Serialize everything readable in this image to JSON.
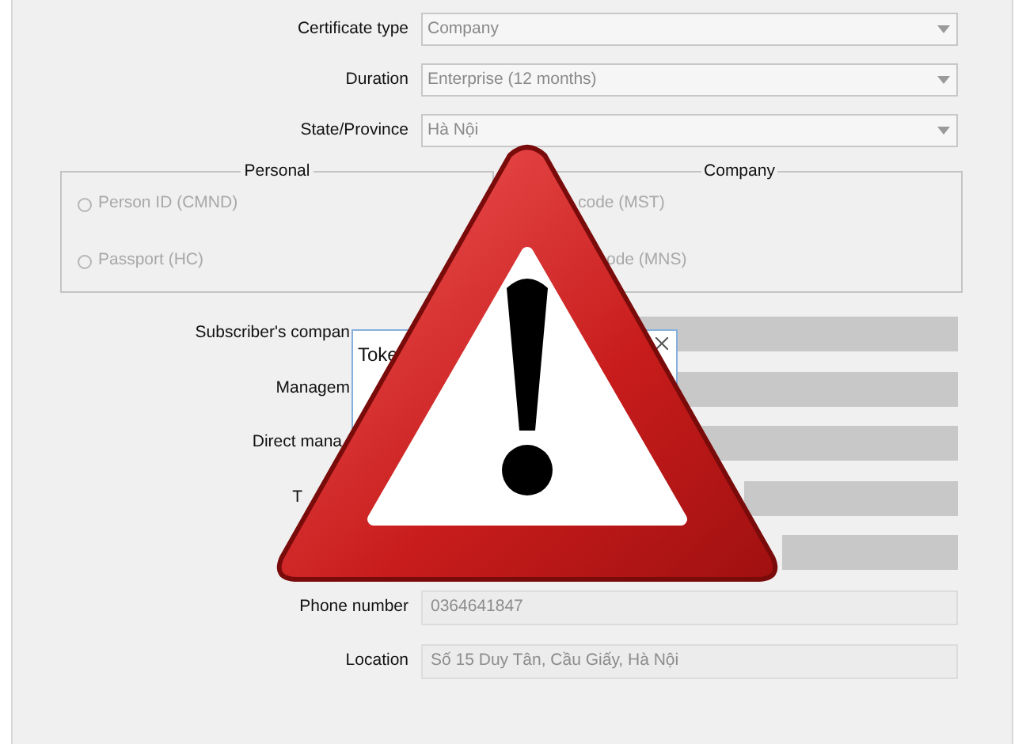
{
  "top_fields": [
    {
      "label": "Certificate type",
      "value": "Company"
    },
    {
      "label": "Duration",
      "value": "Enterprise (12 months)"
    },
    {
      "label": "State/Province",
      "value": "Hà Nội"
    }
  ],
  "groups": [
    {
      "title": "Personal",
      "options": [
        {
          "label": "Person ID (CMND)",
          "selected": false,
          "disabled": true
        },
        {
          "label": "Passport (HC)",
          "selected": false,
          "disabled": true
        }
      ]
    },
    {
      "title": "Company",
      "options": [
        {
          "label": "code (MST)",
          "disabled": true
        },
        {
          "label": "ode (MNS)",
          "disabled": true
        }
      ]
    }
  ],
  "token_dialog": {
    "title": "Toke"
  },
  "fields": [
    {
      "label": "Subscriber's compan",
      "disabled": true
    },
    {
      "label": "Managem",
      "disabled": true
    },
    {
      "label": "Direct mana",
      "disabled": true
    },
    {
      "label": "T",
      "disabled": true
    },
    {
      "disabled": true
    },
    {
      "label": "Phone number",
      "value": "0364641847",
      "disabled": false
    },
    {
      "label": "Location",
      "value": "Số 15 Duy Tân, Cầu Giấy, Hà Nội",
      "disabled": false
    }
  ]
}
